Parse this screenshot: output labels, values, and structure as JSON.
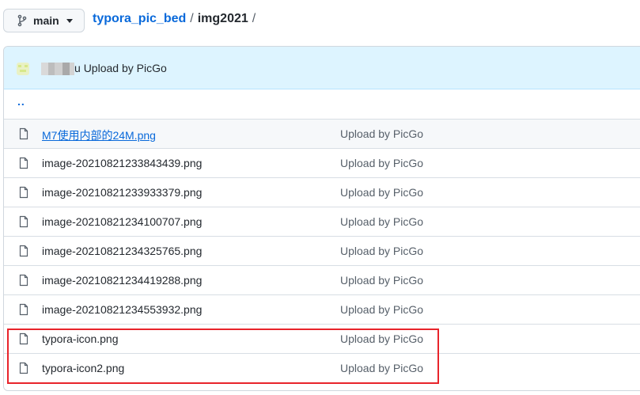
{
  "branch": {
    "label": "main",
    "branch_icon": "git-branch-icon",
    "caret_icon": "caret-down-icon"
  },
  "breadcrumb": {
    "repo": "typora_pic_bed",
    "separator": "/",
    "folder": "img2021",
    "trailing_separator": "/"
  },
  "commit": {
    "user_suffix": "u",
    "message": "Upload by PicGo"
  },
  "parent_dir": {
    "label": ".."
  },
  "files": [
    {
      "name": "M7使用内部的24M.png",
      "message": "Upload by PicGo",
      "link": true
    },
    {
      "name": "image-20210821233843439.png",
      "message": "Upload by PicGo",
      "link": false
    },
    {
      "name": "image-20210821233933379.png",
      "message": "Upload by PicGo",
      "link": false
    },
    {
      "name": "image-20210821234100707.png",
      "message": "Upload by PicGo",
      "link": false
    },
    {
      "name": "image-20210821234325765.png",
      "message": "Upload by PicGo",
      "link": false
    },
    {
      "name": "image-20210821234419288.png",
      "message": "Upload by PicGo",
      "link": false
    },
    {
      "name": "image-20210821234553932.png",
      "message": "Upload by PicGo",
      "link": false
    },
    {
      "name": "typora-icon.png",
      "message": "Upload by PicGo",
      "link": false
    },
    {
      "name": "typora-icon2.png",
      "message": "Upload by PicGo",
      "link": false
    }
  ],
  "colors": {
    "link": "#0969da",
    "commit_bar": "#ddf4ff",
    "highlight": "#e8242b"
  }
}
